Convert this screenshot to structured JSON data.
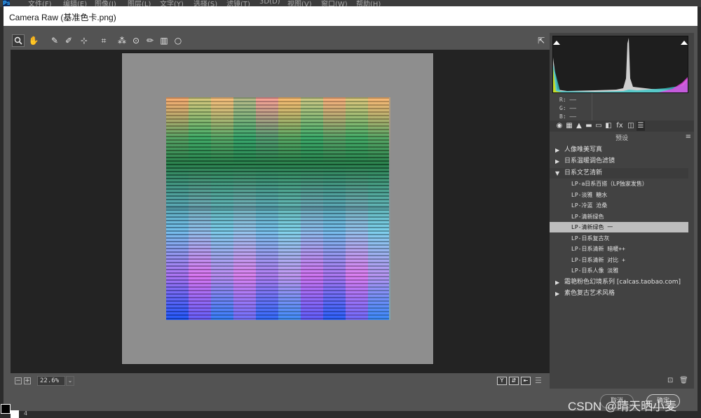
{
  "ps": {
    "menu": [
      "文件(F)",
      "编辑(E)",
      "图像(I)",
      "图层(L)",
      "文字(Y)",
      "选择(S)",
      "滤镜(T)",
      "3D(D)",
      "视图(V)",
      "窗口(W)",
      "帮助(H)"
    ],
    "layer_number": "4"
  },
  "dialog": {
    "title": "Camera Raw (基准色卡.png)"
  },
  "toolbar": {
    "tools": [
      {
        "name": "zoom-tool",
        "icon": "magnifier-icon",
        "glyph": "🔍"
      },
      {
        "name": "hand-tool",
        "icon": "hand-icon",
        "glyph": "✋"
      },
      {
        "name": "white-balance-tool",
        "icon": "eyedropper-icon",
        "glyph": "✎"
      },
      {
        "name": "color-sampler-tool",
        "icon": "color-sampler-icon",
        "glyph": "✐"
      },
      {
        "name": "targeted-adjustment-tool",
        "icon": "target-adjust-icon",
        "glyph": "⊹"
      },
      {
        "name": "crop-tool",
        "icon": "crop-icon",
        "glyph": "⌗"
      },
      {
        "name": "spot-removal-tool",
        "icon": "spot-removal-icon",
        "glyph": "⁂"
      },
      {
        "name": "red-eye-tool",
        "icon": "red-eye-icon",
        "glyph": "⊙"
      },
      {
        "name": "adjustment-brush-tool",
        "icon": "brush-icon",
        "glyph": "✏"
      },
      {
        "name": "graduated-filter-tool",
        "icon": "graduated-filter-icon",
        "glyph": "▥"
      },
      {
        "name": "radial-filter-tool",
        "icon": "radial-filter-icon",
        "glyph": "○"
      }
    ],
    "fullscreen_glyph": "⇱"
  },
  "statusbar": {
    "zoom_out": "−",
    "zoom_in": "+",
    "zoom_value": "22.6%",
    "zoom_dropdown": "⌄",
    "view_buttons": [
      "Y",
      "⇵",
      "⇤"
    ],
    "settings_glyph": "☰"
  },
  "histogram": {
    "rgb_labels": [
      "R:",
      "G:",
      "B:"
    ],
    "rgb_values": [
      "——",
      "——",
      "——"
    ]
  },
  "panel": {
    "tab_glyphs": [
      "◉",
      "▦",
      "▲",
      "▬",
      "▭",
      "◧",
      "fx",
      "◫",
      "☰"
    ],
    "title": "预设",
    "menu_glyph": "≡"
  },
  "presets": [
    {
      "type": "group",
      "open": false,
      "label": "人像唯美写真"
    },
    {
      "type": "group",
      "open": false,
      "label": "日系温暖调色滤镜"
    },
    {
      "type": "group",
      "open": true,
      "label": "日系文艺清新"
    },
    {
      "type": "item",
      "label": "LP-a日系百搭（LP独家发售）"
    },
    {
      "type": "item",
      "label": "LP-淡雅 糖水"
    },
    {
      "type": "item",
      "label": "LP-冷蓝 沧桑"
    },
    {
      "type": "item",
      "label": "LP-清新绿色"
    },
    {
      "type": "item",
      "label": "LP-清新绿色 一",
      "selected": true
    },
    {
      "type": "item",
      "label": "LP-日系复古灰"
    },
    {
      "type": "item",
      "label": "LP-日系清新 暗暖++"
    },
    {
      "type": "item",
      "label": "LP-日系清新 对比 +"
    },
    {
      "type": "item",
      "label": "LP-日系人像 淡雅"
    },
    {
      "type": "group",
      "open": false,
      "label": "霜艳粉色幻境系列 [calcas.taobao.com]"
    },
    {
      "type": "group",
      "open": false,
      "label": "素色复古艺术风格"
    }
  ],
  "panel_bottom": {
    "new_glyph": "⊡",
    "delete_glyph": "🗑"
  },
  "footer": {
    "cancel": "取消",
    "ok": "确定"
  },
  "watermark": "CSDN @晴天晒小麦",
  "colors": {
    "dialog_bg": "#535353",
    "preview_bg": "#232323",
    "canvas_bg": "#8e8e8e",
    "selected_row": "#bdbdbd"
  }
}
